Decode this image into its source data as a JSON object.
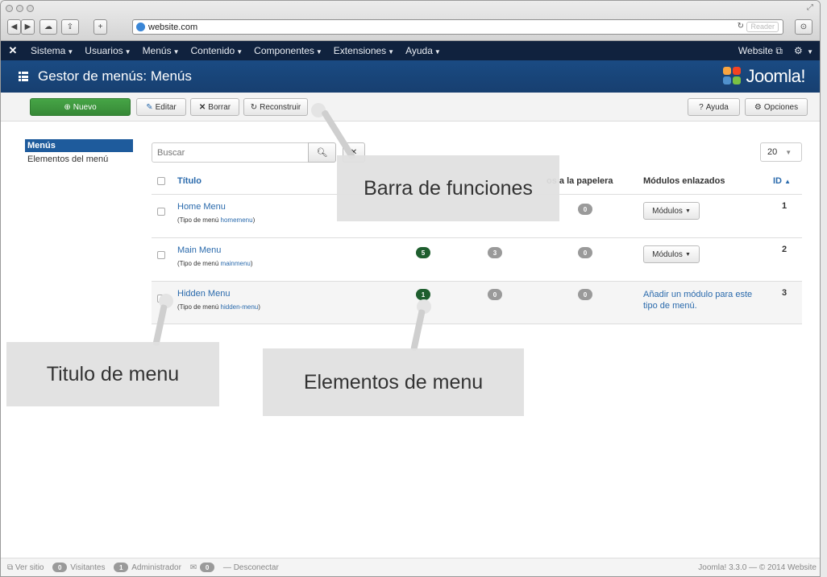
{
  "browser": {
    "url": "website.com",
    "reader_label": "Reader"
  },
  "topnav": {
    "items": [
      "Sistema",
      "Usuarios",
      "Menús",
      "Contenido",
      "Componentes",
      "Extensiones",
      "Ayuda"
    ],
    "website_label": "Website"
  },
  "header": {
    "title": "Gestor de menús: Menús",
    "logo_text": "Joomla!",
    "logo_colors": [
      "#f9a541",
      "#f44321",
      "#5091cd",
      "#7ac143"
    ]
  },
  "toolbar": {
    "new_label": "Nuevo",
    "edit_label": "Editar",
    "delete_label": "Borrar",
    "rebuild_label": "Reconstruir",
    "help_label": "Ayuda",
    "options_label": "Opciones"
  },
  "sidebar": {
    "items": [
      {
        "label": "Menús",
        "active": true
      },
      {
        "label": "Elementos del menú",
        "active": false
      }
    ]
  },
  "filters": {
    "search_placeholder": "Buscar",
    "limit_value": "20"
  },
  "table": {
    "headers": {
      "title": "Título",
      "trash": "os a la papelera",
      "modules": "Módulos enlazados",
      "id": "ID"
    },
    "rows": [
      {
        "title": "Home Menu",
        "type_prefix": "(Tipo de menú",
        "type_value": "homemenu",
        "type_suffix": ")",
        "published": null,
        "unpublished": null,
        "trashed": "0",
        "modules_label": "Módulos",
        "module_link": null,
        "id": "1"
      },
      {
        "title": "Main Menu",
        "type_prefix": "(Tipo de menú",
        "type_value": "mainmenu",
        "type_suffix": ")",
        "published": "5",
        "unpublished": "3",
        "trashed": "0",
        "modules_label": "Módulos",
        "module_link": null,
        "id": "2"
      },
      {
        "title": "Hidden Menu",
        "type_prefix": "(Tipo de menú",
        "type_value": "hidden-menu",
        "type_suffix": ")",
        "published": "1",
        "unpublished": "0",
        "trashed": "0",
        "modules_label": null,
        "module_link": "Añadir un módulo para este tipo de menú.",
        "id": "3"
      }
    ]
  },
  "statusbar": {
    "view_site": "Ver sitio",
    "visitors_count": "0",
    "visitors_label": "Visitantes",
    "admin_count": "1",
    "admin_label": "Administrador",
    "messages_count": "0",
    "logout_label": "Desconectar",
    "version": "Joomla! 3.3.0 — © 2014 Website"
  },
  "annotations": {
    "toolbar_callout": "Barra de funciones",
    "title_callout": "Titulo de menu",
    "items_callout": "Elementos de menu"
  }
}
